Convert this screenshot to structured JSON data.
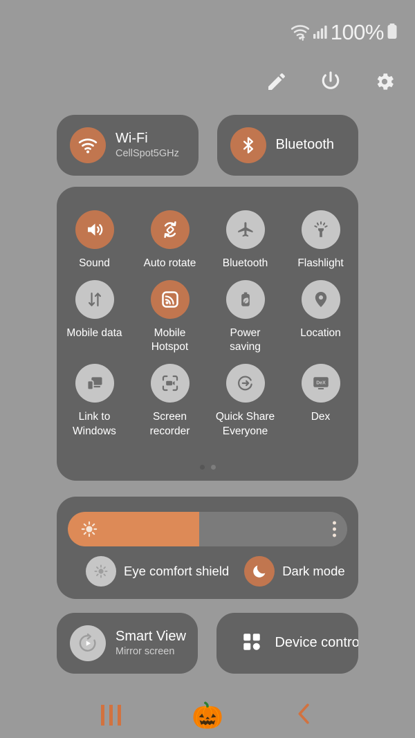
{
  "status_bar": {
    "wifi_icon": "wifi-transfer-icon",
    "signal_icon": "cellular-signal-icon",
    "battery_percent": "100%",
    "battery_icon": "battery-full-icon"
  },
  "header": {
    "buttons": [
      {
        "name": "edit-button",
        "icon": "pencil-icon"
      },
      {
        "name": "power-button",
        "icon": "power-icon"
      },
      {
        "name": "settings-button",
        "icon": "gear-icon"
      }
    ]
  },
  "connection_cards": [
    {
      "title": "Wi-Fi",
      "subtitle": "CellSpot5GHz",
      "icon": "wifi-icon",
      "active": true
    },
    {
      "title": "Bluetooth",
      "subtitle": "",
      "icon": "bluetooth-icon",
      "active": true
    }
  ],
  "toggles": [
    {
      "label": "Sound",
      "icon": "volume-icon",
      "active": true
    },
    {
      "label": "Auto rotate",
      "icon": "auto-rotate-icon",
      "active": true
    },
    {
      "label": "Bluetooth",
      "icon": "airplane-icon",
      "active": false
    },
    {
      "label": "Flashlight",
      "icon": "flashlight-icon",
      "active": false
    },
    {
      "label": "Mobile data",
      "icon": "mobile-data-icon",
      "active": false
    },
    {
      "label": "Mobile Hotspot",
      "icon": "hotspot-icon",
      "active": true
    },
    {
      "label": "Power saving",
      "icon": "battery-leaf-icon",
      "active": false
    },
    {
      "label": "Location",
      "icon": "location-pin-icon",
      "active": false
    },
    {
      "label": "Link to Windows",
      "icon": "link-to-windows-icon",
      "active": false
    },
    {
      "label": "Screen recorder",
      "icon": "screen-recorder-icon",
      "active": false
    },
    {
      "label": "Quick Share Everyone",
      "icon": "quick-share-icon",
      "active": false
    },
    {
      "label": "Dex",
      "icon": "dex-icon",
      "active": false,
      "glyph_text": "DeX"
    }
  ],
  "pagination": {
    "total": 2,
    "active_index": 0
  },
  "brightness": {
    "value_percent": 47,
    "icon": "brightness-sun-icon",
    "menu_icon": "more-options-icon"
  },
  "display_modes": [
    {
      "label": "Eye comfort shield",
      "icon": "eye-comfort-icon",
      "active": false
    },
    {
      "label": "Dark mode",
      "icon": "moon-icon",
      "active": true
    }
  ],
  "bottom_cards": [
    {
      "title": "Smart View",
      "subtitle": "Mirror screen",
      "icon": "smart-view-icon",
      "active": false
    },
    {
      "title": "Device control",
      "subtitle": "",
      "icon": "device-control-grid-icon",
      "active": false
    }
  ],
  "nav_bar": [
    {
      "name": "recents-button",
      "icon": "recents-bars-icon"
    },
    {
      "name": "home-button",
      "icon": "pumpkin-icon",
      "glyph": "🎃"
    },
    {
      "name": "back-button",
      "icon": "back-chevron-icon"
    }
  ],
  "colors": {
    "page_background": "#9a9a9a",
    "card_background": "#636363",
    "accent_active": "#c1764f",
    "slider_fill": "#dd8a57",
    "inactive_circle": "#c6c6c6",
    "nav_accent": "#d2723f"
  }
}
